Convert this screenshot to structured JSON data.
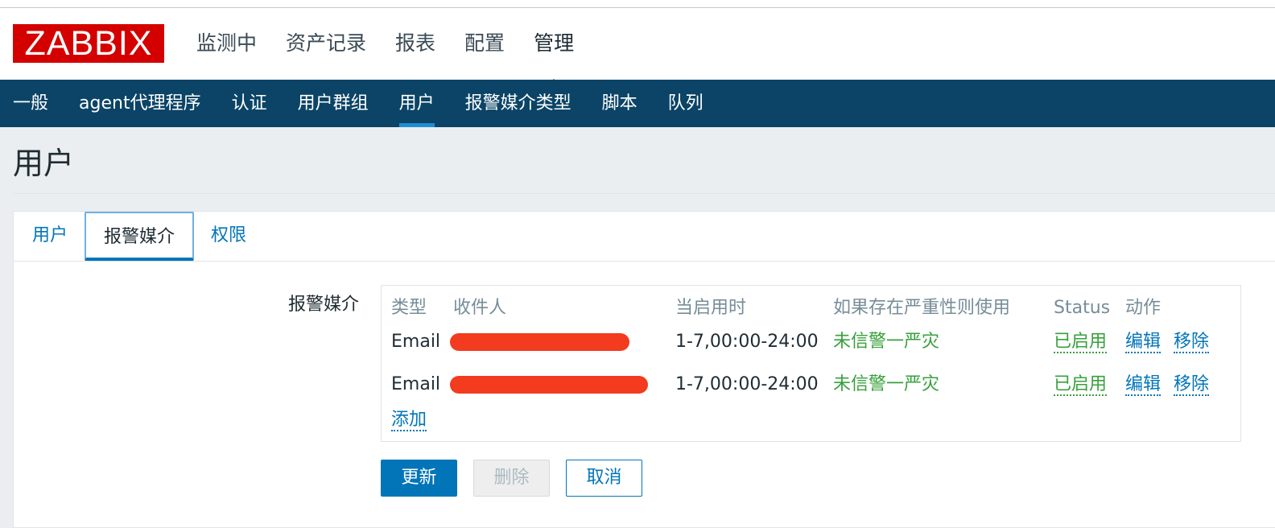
{
  "brand": {
    "logo_text": "ZABBIX",
    "color": "#d40000"
  },
  "main_nav": {
    "items": [
      {
        "label": "监测中"
      },
      {
        "label": "资产记录"
      },
      {
        "label": "报表"
      },
      {
        "label": "配置"
      },
      {
        "label": "管理",
        "active": true
      }
    ]
  },
  "sub_nav": {
    "items": [
      {
        "label": "一般"
      },
      {
        "label": "agent代理程序"
      },
      {
        "label": "认证"
      },
      {
        "label": "用户群组"
      },
      {
        "label": "用户",
        "active": true
      },
      {
        "label": "报警媒介类型"
      },
      {
        "label": "脚本"
      },
      {
        "label": "队列"
      }
    ]
  },
  "page": {
    "title": "用户"
  },
  "tabs": [
    {
      "label": "用户"
    },
    {
      "label": "报警媒介",
      "active": true
    },
    {
      "label": "权限"
    }
  ],
  "media": {
    "field_label": "报警媒介",
    "columns": [
      "类型",
      "收件人",
      "当启用时",
      "如果存在严重性则使用",
      "Status",
      "动作"
    ],
    "rows": [
      {
        "type": "Email",
        "recipient_redacted": true,
        "when_active": "1-7,00:00-24:00",
        "severity": "未信警一严灾",
        "status": "已启用",
        "actions": [
          "编辑",
          "移除"
        ]
      },
      {
        "type": "Email",
        "recipient_redacted": true,
        "when_active": "1-7,00:00-24:00",
        "severity": "未信警一严灾",
        "status": "已启用",
        "actions": [
          "编辑",
          "移除"
        ]
      }
    ],
    "add_label": "添加"
  },
  "buttons": {
    "update": "更新",
    "delete": "删除",
    "cancel": "取消"
  },
  "colors": {
    "nav_bg": "#0b4466",
    "accent": "#0275b8",
    "enabled": "#37a13b",
    "redaction": "#f33b1f"
  }
}
